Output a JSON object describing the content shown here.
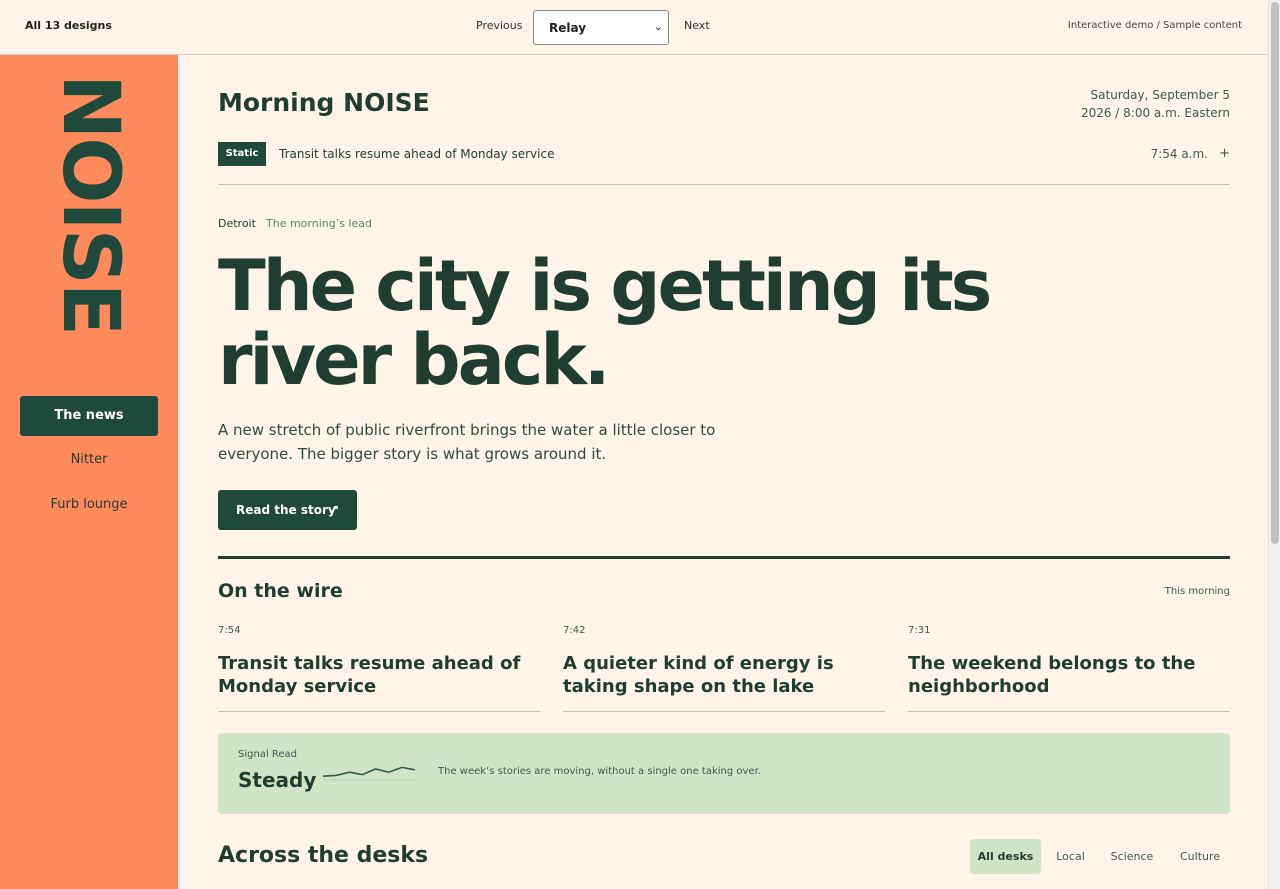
{
  "topbar": {
    "all_designs": "All 13 designs",
    "previous": "Previous",
    "design_selected": "Relay",
    "next": "Next",
    "meta": "Interactive demo / Sample content"
  },
  "sidebar": {
    "brand": "NOISE",
    "nav": [
      {
        "label": "The news",
        "active": true
      },
      {
        "label": "Nitter",
        "active": false
      },
      {
        "label": "Furb lounge",
        "active": false
      }
    ]
  },
  "masthead": {
    "title": "Morning NOISE",
    "date_line1": "Saturday, September 5",
    "date_line2": "2026 / 8:00 a.m. Eastern"
  },
  "ticker": {
    "tag": "Static",
    "text": "Transit talks resume ahead of Monday service",
    "time": "7:54 a.m.",
    "plus": "+"
  },
  "lead": {
    "location": "Detroit",
    "kicker": "The morning’s lead",
    "headline": "The city is getting its river back.",
    "dek": "A new stretch of public riverfront brings the water a little closer to everyone. The bigger story is what grows around it.",
    "button": "Read the story",
    "button_icon": "arrow-up-right-icon"
  },
  "wire": {
    "title": "On the wire",
    "when": "This morning",
    "items": [
      {
        "time": "7:54",
        "headline": "Transit talks resume ahead of Monday service"
      },
      {
        "time": "7:42",
        "headline": "A quieter kind of energy is taking shape on the lake"
      },
      {
        "time": "7:31",
        "headline": "The weekend belongs to the neighborhood"
      }
    ]
  },
  "signal": {
    "label": "Signal Read",
    "value": "Steady",
    "description": "The week’s stories are moving, without a single one taking over.",
    "sparkline": [
      0.3,
      0.35,
      0.55,
      0.4,
      0.75,
      0.55,
      0.85,
      0.7
    ]
  },
  "desks": {
    "title": "Across the desks",
    "filters": [
      {
        "label": "All desks",
        "active": true
      },
      {
        "label": "Local",
        "active": false
      },
      {
        "label": "Science",
        "active": false
      },
      {
        "label": "Culture",
        "active": false
      }
    ]
  },
  "colors": {
    "page_bg": "#fff4ea",
    "sidebar_bg": "#ff8a5c",
    "accent_dark": "#1f4a3b",
    "signal_bg": "#d1e4c5",
    "kicker_green": "#4f8a64"
  }
}
